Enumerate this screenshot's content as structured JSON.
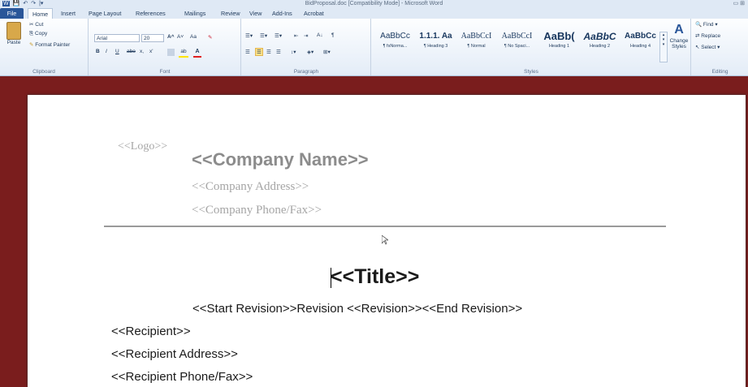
{
  "titlebar": {
    "title": "BidProposal.doc [Compatibility Mode] - Microsoft Word",
    "qat": [
      "W",
      "💾",
      "↶",
      "↷",
      "|▾"
    ],
    "window_controls": "▭  ⊞"
  },
  "tabs": [
    "File",
    "Home",
    "Insert",
    "Page Layout",
    "References",
    "Mailings",
    "Review",
    "View",
    "Add-Ins",
    "Acrobat"
  ],
  "clipboard": {
    "label": "Clipboard",
    "paste": "Paste",
    "cut": "Cut",
    "copy": "Copy",
    "format_painter": "Format Painter"
  },
  "font": {
    "label": "Font",
    "family": "Arial",
    "size": "20",
    "bold": "B",
    "italic": "I",
    "underline": "U",
    "strike": "abe",
    "sub": "x,",
    "sup": "x'",
    "grow": "A^",
    "shrink": "A˅",
    "case": "Aa",
    "clear": "A"
  },
  "paragraph": {
    "label": "Paragraph",
    "sort": "A↓",
    "pilcrow": "¶"
  },
  "styles": {
    "label": "Styles",
    "items": [
      {
        "sample": "AaBbCc",
        "name": "¶ fsNorma..."
      },
      {
        "sample": "1.1.1. Aa",
        "name": "¶ Heading 3"
      },
      {
        "sample": "AaBbCcI",
        "name": "¶ Normal"
      },
      {
        "sample": "AaBbCcI",
        "name": "¶ No Spaci..."
      },
      {
        "sample": "AaBb(",
        "name": "Heading 1"
      },
      {
        "sample": "AaBbC",
        "name": "Heading 2"
      },
      {
        "sample": "AaBbCc",
        "name": "Heading 4"
      }
    ],
    "change_styles": "Change Styles"
  },
  "editing": {
    "label": "Editing",
    "find": "Find",
    "replace": "Replace",
    "select": "Select"
  },
  "document": {
    "logo": "<<Logo>>",
    "company_name": "<<Company Name>>",
    "company_address": "<<Company Address>>",
    "company_phone": "<<Company Phone/Fax>>",
    "title": "<<Title>>",
    "revision_line": "<<Start Revision>>Revision <<Revision>><<End Revision>>",
    "recipient": "<<Recipient>>",
    "recipient_address": "<<Recipient Address>>",
    "recipient_phone": "<<Recipient Phone/Fax>>"
  }
}
